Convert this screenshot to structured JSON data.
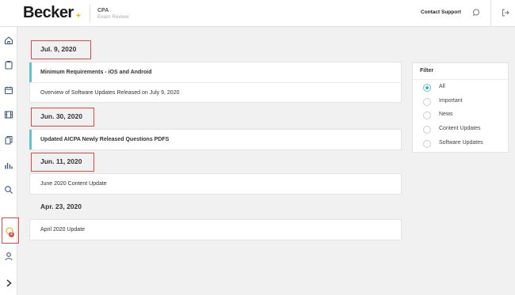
{
  "header": {
    "logo": "Becker",
    "logo_mark": "+",
    "product_title": "CPA",
    "product_subtitle": "Exam Review",
    "contact_support": "Contact Support"
  },
  "sidebar": {
    "items": [
      {
        "icon": "home-icon"
      },
      {
        "icon": "clipboard-icon"
      },
      {
        "icon": "calendar-icon"
      },
      {
        "icon": "film-icon"
      },
      {
        "icon": "flashcards-icon"
      },
      {
        "icon": "bar-chart-icon"
      },
      {
        "icon": "search-icon"
      },
      {
        "icon": "notifications-icon",
        "badge": "2"
      },
      {
        "icon": "user-icon"
      },
      {
        "icon": "chevron-right-icon"
      }
    ]
  },
  "updates": [
    {
      "date": "Jul. 9, 2020",
      "items": [
        {
          "title": "Minimum Requirements - iOS and Android",
          "bold": true
        },
        {
          "title": "Overview of Software Updates Released on July 9, 2020",
          "bold": false
        }
      ]
    },
    {
      "date": "Jun. 30, 2020",
      "items": [
        {
          "title": "Updated AICPA Newly Released Questions PDFS",
          "bold": true
        }
      ]
    },
    {
      "date": "Jun. 11, 2020",
      "items": [
        {
          "title": "June 2020 Content Update",
          "bold": false
        }
      ]
    },
    {
      "date": "Apr. 23, 2020",
      "items": [
        {
          "title": "April 2020 Update",
          "bold": false
        }
      ]
    }
  ],
  "filter": {
    "title": "Filter",
    "selected": "All",
    "options": [
      "All",
      "Important",
      "News",
      "Content Updates",
      "Software Updates"
    ]
  },
  "colors": {
    "accent": "#64c4ce",
    "radio_selected": "#3fb9a4",
    "highlight": "#e04a4a",
    "brand": "#f2a900"
  }
}
